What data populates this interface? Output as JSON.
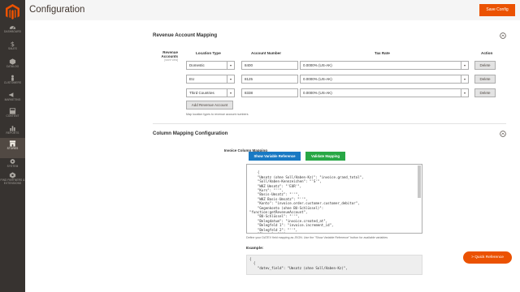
{
  "header": {
    "title": "Configuration",
    "save_label": "Save Config"
  },
  "sidebar": {
    "items": [
      {
        "label": "Dashboard",
        "icon": "dashboard-icon"
      },
      {
        "label": "Sales",
        "icon": "dollar-icon"
      },
      {
        "label": "Catalog",
        "icon": "cube-icon"
      },
      {
        "label": "Customers",
        "icon": "person-icon"
      },
      {
        "label": "Marketing",
        "icon": "megaphone-icon"
      },
      {
        "label": "Content",
        "icon": "layout-icon"
      },
      {
        "label": "Reports",
        "icon": "bar-chart-icon"
      },
      {
        "label": "Stores",
        "icon": "store-icon",
        "active": true
      },
      {
        "label": "System",
        "icon": "gear-icon"
      },
      {
        "label": "Find Partners & Extensions",
        "icon": "partners-icon"
      }
    ]
  },
  "revenue": {
    "title": "Revenue Account Mapping",
    "field_label": "Revenue Accounts",
    "scope": "[store view]",
    "columns": {
      "location": "Location Type",
      "account": "Account Number",
      "tax": "Tax Rate",
      "action": "Action"
    },
    "rows": [
      {
        "location": "Domestic",
        "account": "8400",
        "tax": "0.0000% (US-AK)",
        "action": "Delete"
      },
      {
        "location": "EU",
        "account": "8125",
        "tax": "0.0000% (US-AK)",
        "action": "Delete"
      },
      {
        "location": "Third Countries",
        "account": "8338",
        "tax": "0.0000% (US-AK)",
        "action": "Delete"
      }
    ],
    "add_label": "Add Revenue Account",
    "note": "Map location types to revenue account numbers"
  },
  "column_mapping": {
    "title": "Column Mapping Configuration",
    "field_label": "Invoice Column Mapping",
    "scope": "[store view]",
    "show_ref_label": "Show Variable Reference",
    "validate_label": "Validate Mapping",
    "code": "{\n    \"Umsatz (ohne Soll/Haben-Kz)\": \"invoice.grand_total\",\n    \"Soll/Haben-Kennzeichen\": \"'S'\",\n    \"WKZ Umsatz\": \"'EUR'\",\n    \"Kurs\": \"''\",\n    \"Basis-Umsatz\": \"''\",\n    \"WKZ Basis-Umsatz\": \"''\",\n    \"Konto\": \"invoice.order.customer.customer_debitor\",\n    \"Gegenkonto (ohne BU-Schlüssel)\":\n\"function:getRevenueAccount\",\n    \"BU-Schlüssel\": \"''\",\n    \"Belegdatum\": \"invoice.created_at\",\n    \"Belegfeld 1\": \"invoice.increment_id\",\n    \"Belegfeld 2\": \"''\",\n    \"Skonto\": \"''\",",
    "note": "Define your DATEV field mapping as JSON. Use the \"Show Variable Reference\" button for available variables",
    "example_title": "Example:",
    "example_code": "{\n  {\n    \"datev_field\": \"Umsatz (ohne Soll/Haben-Kz)\","
  },
  "quick_ref_label": "> Quick Reference",
  "colors": {
    "accent": "#eb5202",
    "sidebar": "#373330",
    "blue": "#1979c3",
    "green": "#28a745"
  }
}
